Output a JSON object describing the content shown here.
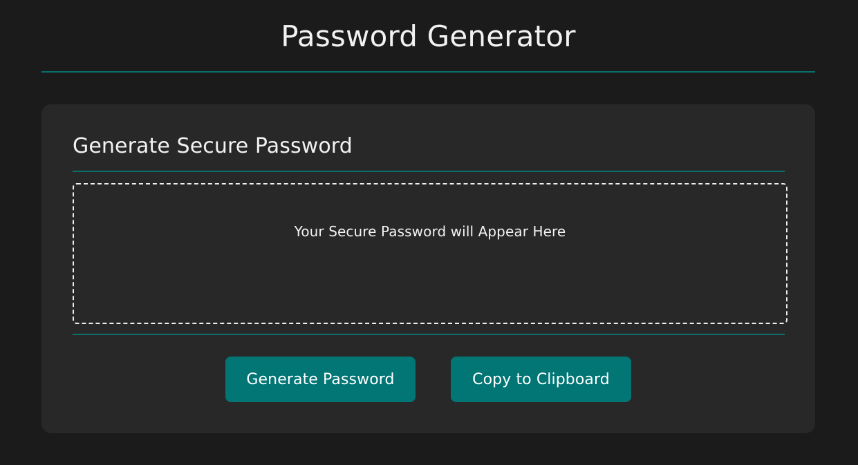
{
  "header": {
    "title": "Password Generator"
  },
  "card": {
    "title": "Generate Secure Password",
    "password_placeholder": "Your Secure Password will Appear Here",
    "generate_button_label": "Generate Password",
    "copy_button_label": "Copy to Clipboard"
  },
  "colors": {
    "background": "#1b1b1b",
    "card_background": "#282828",
    "accent": "#027575",
    "rule": "#0b6f6f",
    "text": "#f2f2f2"
  }
}
